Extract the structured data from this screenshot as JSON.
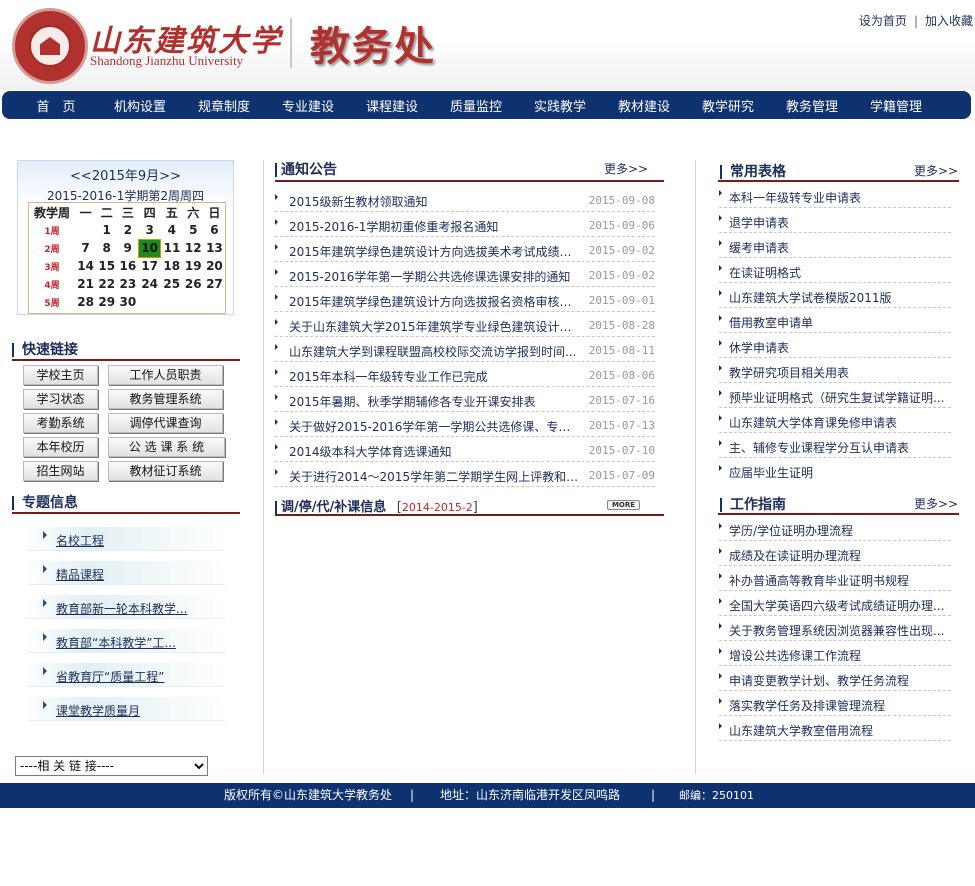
{
  "header": {
    "univ_cn": "山东建筑大学",
    "univ_en": "Shandong Jianzhu University",
    "dept_title": "教务处",
    "top_links": [
      "设为首页",
      "加入收藏"
    ]
  },
  "nav": [
    "首　页",
    "机构设置",
    "规章制度",
    "专业建设",
    "课程建设",
    "质量监控",
    "实践教学",
    "教材建设",
    "教学研究",
    "教务管理",
    "学籍管理"
  ],
  "calendar": {
    "month_label": "<<2015年9月>>",
    "term_label": "2015-2016-1学期第2周周四",
    "headers": [
      "教学周",
      "一",
      "二",
      "三",
      "四",
      "五",
      "六",
      "日"
    ],
    "rows": [
      {
        "week": "1周",
        "days": [
          "",
          "1",
          "2",
          "3",
          "4",
          "5",
          "6"
        ]
      },
      {
        "week": "2周",
        "days": [
          "7",
          "8",
          "9",
          "10",
          "11",
          "12",
          "13"
        ]
      },
      {
        "week": "3周",
        "days": [
          "14",
          "15",
          "16",
          "17",
          "18",
          "19",
          "20"
        ]
      },
      {
        "week": "4周",
        "days": [
          "21",
          "22",
          "23",
          "24",
          "25",
          "26",
          "27"
        ]
      },
      {
        "week": "5周",
        "days": [
          "28",
          "29",
          "30",
          "",
          "",
          "",
          ""
        ]
      }
    ],
    "today": "10"
  },
  "quick_links": {
    "title": "快速链接",
    "items": [
      "学校主页",
      "工作人员职责",
      "学习状态",
      "教务管理系统",
      "考勤系统",
      "调停代课查询",
      "本年校历",
      "公 选 课 系 统",
      "招生网站",
      "教材征订系统"
    ]
  },
  "topics": {
    "title": "专题信息",
    "items": [
      "名校工程",
      "精品课程",
      "教育部新一轮本科教学...",
      "教育部“本科教学”工...",
      "省教育厅“质量工程”",
      "课堂教学质量月"
    ]
  },
  "link_select": "----相 关 链 接----",
  "notices": {
    "title": "通知公告",
    "more": "更多>>",
    "items": [
      {
        "title": "2015级新生教材领取通知",
        "date": "2015-09-08"
      },
      {
        "title": "2015-2016-1学期初重修重考报名通知",
        "date": "2015-09-06"
      },
      {
        "title": "2015年建筑学绿色建筑设计方向选拔美术考试成绩及...",
        "date": "2015-09-02"
      },
      {
        "title": "2015-2016学年第一学期公共选修课选课安排的通知",
        "date": "2015-09-02"
      },
      {
        "title": "2015年建筑学绿色建筑设计方向选拔报名资格审核结...",
        "date": "2015-09-01"
      },
      {
        "title": "关于山东建筑大学2015年建筑学专业绿色建筑设计方...",
        "date": "2015-08-28"
      },
      {
        "title": "山东建筑大学到课程联盟高校校际交流访学报到时间...",
        "date": "2015-08-11"
      },
      {
        "title": "2015年本科一年级转专业工作已完成",
        "date": "2015-08-06"
      },
      {
        "title": "2015年暑期、秋季学期辅修各专业开课安排表",
        "date": "2015-07-16"
      },
      {
        "title": "关于做好2015-2016学年第一学期公共选修课、专业...",
        "date": "2015-07-13"
      },
      {
        "title": "2014级本科大学体育选课通知",
        "date": "2015-07-10"
      },
      {
        "title": "关于进行2014～2015学年第二学期学生网上评教和教...",
        "date": "2015-07-09"
      }
    ]
  },
  "course_changes": {
    "title": "调/停/代/补课信息",
    "term": "2014-2015-2",
    "bracket_open": "[",
    "bracket_close": "]",
    "more": "MORE"
  },
  "forms": {
    "title": "常用表格",
    "more": "更多>>",
    "items": [
      "本科一年级转专业申请表",
      "退学申请表",
      "缓考申请表",
      "在读证明格式",
      "山东建筑大学试卷模版2011版",
      "借用教室申请单",
      "休学申请表",
      "教学研究项目相关用表",
      "预毕业证明格式（研究生复试学籍证明...",
      "山东建筑大学体育课免修申请表",
      "主、辅修专业课程学分互认申请表",
      "应届毕业生证明"
    ]
  },
  "guide": {
    "title": "工作指南",
    "more": "更多>>",
    "items": [
      "学历/学位证明办理流程",
      "成绩及在读证明办理流程",
      "补办普通高等教育毕业证明书规程",
      "全国大学英语四六级考试成绩证明办理...",
      "关于教务管理系统因浏览器兼容性出现...",
      "增设公共选修课工作流程",
      "申请变更教学计划、教学任务流程",
      "落实教学任务及排课管理流程",
      "山东建筑大学教室借用流程"
    ]
  },
  "footer": {
    "copyright": "版权所有©山东建筑大学教务处",
    "sep": "|",
    "address": "地址：山东济南临港开发区凤鸣路",
    "postcode": "邮编：250101"
  },
  "colors": {
    "nav_bg": "#0e3170",
    "brand_red": "#b1312f",
    "today_bg": "#1c8a1c"
  }
}
